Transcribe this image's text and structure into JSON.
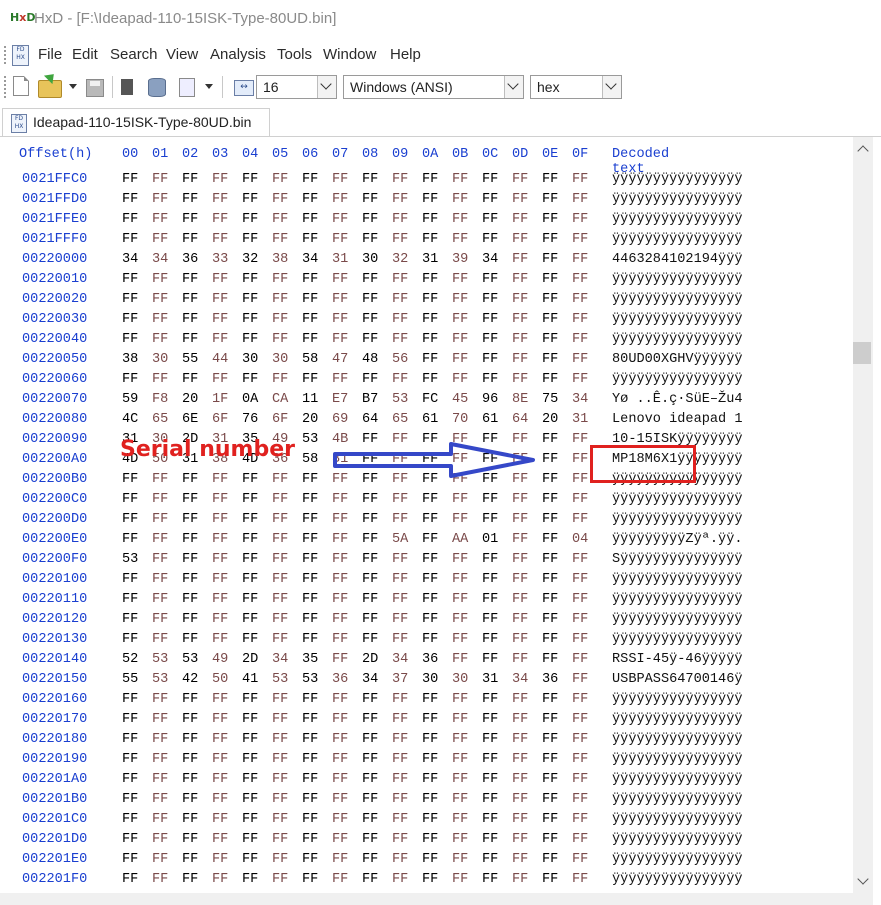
{
  "window": {
    "app_name": "HxD",
    "title": "HxD - [F:\\Ideapad-110-15ISK-Type-80UD.bin]",
    "icon": "hxd-app-icon"
  },
  "menu": {
    "doc_icon_text": "FD HX",
    "items": [
      "File",
      "Edit",
      "Search",
      "View",
      "Analysis",
      "Tools",
      "Window",
      "Help"
    ]
  },
  "toolbar": {
    "bytes_per_row": "16",
    "charset": "Windows (ANSI)",
    "offset_base": "hex",
    "icons": [
      "new-file-icon",
      "open-file-icon",
      "save-icon",
      "close-file-icon",
      "disk-icon",
      "file-properties-icon",
      "columns-icon"
    ]
  },
  "tab": {
    "label": "Ideapad-110-15ISK-Type-80UD.bin",
    "icon_text": "FD HX"
  },
  "editor": {
    "offset_header": "Offset(h)",
    "columns": [
      "00",
      "01",
      "02",
      "03",
      "04",
      "05",
      "06",
      "07",
      "08",
      "09",
      "0A",
      "0B",
      "0C",
      "0D",
      "0E",
      "0F"
    ],
    "decoded_header": "Decoded text",
    "rows": [
      {
        "offset": "0021FFC0",
        "bytes": [
          "FF",
          "FF",
          "FF",
          "FF",
          "FF",
          "FF",
          "FF",
          "FF",
          "FF",
          "FF",
          "FF",
          "FF",
          "FF",
          "FF",
          "FF",
          "FF"
        ],
        "text": "ÿÿÿÿÿÿÿÿÿÿÿÿÿÿÿÿ"
      },
      {
        "offset": "0021FFD0",
        "bytes": [
          "FF",
          "FF",
          "FF",
          "FF",
          "FF",
          "FF",
          "FF",
          "FF",
          "FF",
          "FF",
          "FF",
          "FF",
          "FF",
          "FF",
          "FF",
          "FF"
        ],
        "text": "ÿÿÿÿÿÿÿÿÿÿÿÿÿÿÿÿ"
      },
      {
        "offset": "0021FFE0",
        "bytes": [
          "FF",
          "FF",
          "FF",
          "FF",
          "FF",
          "FF",
          "FF",
          "FF",
          "FF",
          "FF",
          "FF",
          "FF",
          "FF",
          "FF",
          "FF",
          "FF"
        ],
        "text": "ÿÿÿÿÿÿÿÿÿÿÿÿÿÿÿÿ"
      },
      {
        "offset": "0021FFF0",
        "bytes": [
          "FF",
          "FF",
          "FF",
          "FF",
          "FF",
          "FF",
          "FF",
          "FF",
          "FF",
          "FF",
          "FF",
          "FF",
          "FF",
          "FF",
          "FF",
          "FF"
        ],
        "text": "ÿÿÿÿÿÿÿÿÿÿÿÿÿÿÿÿ"
      },
      {
        "offset": "00220000",
        "bytes": [
          "34",
          "34",
          "36",
          "33",
          "32",
          "38",
          "34",
          "31",
          "30",
          "32",
          "31",
          "39",
          "34",
          "FF",
          "FF",
          "FF"
        ],
        "text": "4463284102194ÿÿÿ"
      },
      {
        "offset": "00220010",
        "bytes": [
          "FF",
          "FF",
          "FF",
          "FF",
          "FF",
          "FF",
          "FF",
          "FF",
          "FF",
          "FF",
          "FF",
          "FF",
          "FF",
          "FF",
          "FF",
          "FF"
        ],
        "text": "ÿÿÿÿÿÿÿÿÿÿÿÿÿÿÿÿ"
      },
      {
        "offset": "00220020",
        "bytes": [
          "FF",
          "FF",
          "FF",
          "FF",
          "FF",
          "FF",
          "FF",
          "FF",
          "FF",
          "FF",
          "FF",
          "FF",
          "FF",
          "FF",
          "FF",
          "FF"
        ],
        "text": "ÿÿÿÿÿÿÿÿÿÿÿÿÿÿÿÿ"
      },
      {
        "offset": "00220030",
        "bytes": [
          "FF",
          "FF",
          "FF",
          "FF",
          "FF",
          "FF",
          "FF",
          "FF",
          "FF",
          "FF",
          "FF",
          "FF",
          "FF",
          "FF",
          "FF",
          "FF"
        ],
        "text": "ÿÿÿÿÿÿÿÿÿÿÿÿÿÿÿÿ"
      },
      {
        "offset": "00220040",
        "bytes": [
          "FF",
          "FF",
          "FF",
          "FF",
          "FF",
          "FF",
          "FF",
          "FF",
          "FF",
          "FF",
          "FF",
          "FF",
          "FF",
          "FF",
          "FF",
          "FF"
        ],
        "text": "ÿÿÿÿÿÿÿÿÿÿÿÿÿÿÿÿ"
      },
      {
        "offset": "00220050",
        "bytes": [
          "38",
          "30",
          "55",
          "44",
          "30",
          "30",
          "58",
          "47",
          "48",
          "56",
          "FF",
          "FF",
          "FF",
          "FF",
          "FF",
          "FF"
        ],
        "text": "80UD00XGHVÿÿÿÿÿÿ"
      },
      {
        "offset": "00220060",
        "bytes": [
          "FF",
          "FF",
          "FF",
          "FF",
          "FF",
          "FF",
          "FF",
          "FF",
          "FF",
          "FF",
          "FF",
          "FF",
          "FF",
          "FF",
          "FF",
          "FF"
        ],
        "text": "ÿÿÿÿÿÿÿÿÿÿÿÿÿÿÿÿ"
      },
      {
        "offset": "00220070",
        "bytes": [
          "59",
          "F8",
          "20",
          "1F",
          "0A",
          "CA",
          "11",
          "E7",
          "B7",
          "53",
          "FC",
          "45",
          "96",
          "8E",
          "75",
          "34"
        ],
        "text": "Yø ..Ê.ç·SüE–Žu4"
      },
      {
        "offset": "00220080",
        "bytes": [
          "4C",
          "65",
          "6E",
          "6F",
          "76",
          "6F",
          "20",
          "69",
          "64",
          "65",
          "61",
          "70",
          "61",
          "64",
          "20",
          "31"
        ],
        "text": "Lenovo ideapad 1"
      },
      {
        "offset": "00220090",
        "bytes": [
          "31",
          "30",
          "2D",
          "31",
          "35",
          "49",
          "53",
          "4B",
          "FF",
          "FF",
          "FF",
          "FF",
          "FF",
          "FF",
          "FF",
          "FF"
        ],
        "text": "10-15ISKÿÿÿÿÿÿÿÿ"
      },
      {
        "offset": "002200A0",
        "bytes": [
          "4D",
          "50",
          "31",
          "38",
          "4D",
          "36",
          "58",
          "31",
          "FF",
          "FF",
          "FF",
          "FF",
          "FF",
          "FF",
          "FF",
          "FF"
        ],
        "text": "MP18M6X1ÿÿÿÿÿÿÿÿ"
      },
      {
        "offset": "002200B0",
        "bytes": [
          "FF",
          "FF",
          "FF",
          "FF",
          "FF",
          "FF",
          "FF",
          "FF",
          "FF",
          "FF",
          "FF",
          "FF",
          "FF",
          "FF",
          "FF",
          "FF"
        ],
        "text": "ÿÿÿÿÿÿÿÿÿÿÿÿÿÿÿÿ"
      },
      {
        "offset": "002200C0",
        "bytes": [
          "FF",
          "FF",
          "FF",
          "FF",
          "FF",
          "FF",
          "FF",
          "FF",
          "FF",
          "FF",
          "FF",
          "FF",
          "FF",
          "FF",
          "FF",
          "FF"
        ],
        "text": "ÿÿÿÿÿÿÿÿÿÿÿÿÿÿÿÿ"
      },
      {
        "offset": "002200D0",
        "bytes": [
          "FF",
          "FF",
          "FF",
          "FF",
          "FF",
          "FF",
          "FF",
          "FF",
          "FF",
          "FF",
          "FF",
          "FF",
          "FF",
          "FF",
          "FF",
          "FF"
        ],
        "text": "ÿÿÿÿÿÿÿÿÿÿÿÿÿÿÿÿ"
      },
      {
        "offset": "002200E0",
        "bytes": [
          "FF",
          "FF",
          "FF",
          "FF",
          "FF",
          "FF",
          "FF",
          "FF",
          "FF",
          "5A",
          "FF",
          "AA",
          "01",
          "FF",
          "FF",
          "04"
        ],
        "text": "ÿÿÿÿÿÿÿÿÿZÿª.ÿÿ."
      },
      {
        "offset": "002200F0",
        "bytes": [
          "53",
          "FF",
          "FF",
          "FF",
          "FF",
          "FF",
          "FF",
          "FF",
          "FF",
          "FF",
          "FF",
          "FF",
          "FF",
          "FF",
          "FF",
          "FF"
        ],
        "text": "Sÿÿÿÿÿÿÿÿÿÿÿÿÿÿÿ"
      },
      {
        "offset": "00220100",
        "bytes": [
          "FF",
          "FF",
          "FF",
          "FF",
          "FF",
          "FF",
          "FF",
          "FF",
          "FF",
          "FF",
          "FF",
          "FF",
          "FF",
          "FF",
          "FF",
          "FF"
        ],
        "text": "ÿÿÿÿÿÿÿÿÿÿÿÿÿÿÿÿ"
      },
      {
        "offset": "00220110",
        "bytes": [
          "FF",
          "FF",
          "FF",
          "FF",
          "FF",
          "FF",
          "FF",
          "FF",
          "FF",
          "FF",
          "FF",
          "FF",
          "FF",
          "FF",
          "FF",
          "FF"
        ],
        "text": "ÿÿÿÿÿÿÿÿÿÿÿÿÿÿÿÿ"
      },
      {
        "offset": "00220120",
        "bytes": [
          "FF",
          "FF",
          "FF",
          "FF",
          "FF",
          "FF",
          "FF",
          "FF",
          "FF",
          "FF",
          "FF",
          "FF",
          "FF",
          "FF",
          "FF",
          "FF"
        ],
        "text": "ÿÿÿÿÿÿÿÿÿÿÿÿÿÿÿÿ"
      },
      {
        "offset": "00220130",
        "bytes": [
          "FF",
          "FF",
          "FF",
          "FF",
          "FF",
          "FF",
          "FF",
          "FF",
          "FF",
          "FF",
          "FF",
          "FF",
          "FF",
          "FF",
          "FF",
          "FF"
        ],
        "text": "ÿÿÿÿÿÿÿÿÿÿÿÿÿÿÿÿ"
      },
      {
        "offset": "00220140",
        "bytes": [
          "52",
          "53",
          "53",
          "49",
          "2D",
          "34",
          "35",
          "FF",
          "2D",
          "34",
          "36",
          "FF",
          "FF",
          "FF",
          "FF",
          "FF"
        ],
        "text": "RSSI-45ÿ-46ÿÿÿÿÿ"
      },
      {
        "offset": "00220150",
        "bytes": [
          "55",
          "53",
          "42",
          "50",
          "41",
          "53",
          "53",
          "36",
          "34",
          "37",
          "30",
          "30",
          "31",
          "34",
          "36",
          "FF"
        ],
        "text": "USBPASS64700146ÿ"
      },
      {
        "offset": "00220160",
        "bytes": [
          "FF",
          "FF",
          "FF",
          "FF",
          "FF",
          "FF",
          "FF",
          "FF",
          "FF",
          "FF",
          "FF",
          "FF",
          "FF",
          "FF",
          "FF",
          "FF"
        ],
        "text": "ÿÿÿÿÿÿÿÿÿÿÿÿÿÿÿÿ"
      },
      {
        "offset": "00220170",
        "bytes": [
          "FF",
          "FF",
          "FF",
          "FF",
          "FF",
          "FF",
          "FF",
          "FF",
          "FF",
          "FF",
          "FF",
          "FF",
          "FF",
          "FF",
          "FF",
          "FF"
        ],
        "text": "ÿÿÿÿÿÿÿÿÿÿÿÿÿÿÿÿ"
      },
      {
        "offset": "00220180",
        "bytes": [
          "FF",
          "FF",
          "FF",
          "FF",
          "FF",
          "FF",
          "FF",
          "FF",
          "FF",
          "FF",
          "FF",
          "FF",
          "FF",
          "FF",
          "FF",
          "FF"
        ],
        "text": "ÿÿÿÿÿÿÿÿÿÿÿÿÿÿÿÿ"
      },
      {
        "offset": "00220190",
        "bytes": [
          "FF",
          "FF",
          "FF",
          "FF",
          "FF",
          "FF",
          "FF",
          "FF",
          "FF",
          "FF",
          "FF",
          "FF",
          "FF",
          "FF",
          "FF",
          "FF"
        ],
        "text": "ÿÿÿÿÿÿÿÿÿÿÿÿÿÿÿÿ"
      },
      {
        "offset": "002201A0",
        "bytes": [
          "FF",
          "FF",
          "FF",
          "FF",
          "FF",
          "FF",
          "FF",
          "FF",
          "FF",
          "FF",
          "FF",
          "FF",
          "FF",
          "FF",
          "FF",
          "FF"
        ],
        "text": "ÿÿÿÿÿÿÿÿÿÿÿÿÿÿÿÿ"
      },
      {
        "offset": "002201B0",
        "bytes": [
          "FF",
          "FF",
          "FF",
          "FF",
          "FF",
          "FF",
          "FF",
          "FF",
          "FF",
          "FF",
          "FF",
          "FF",
          "FF",
          "FF",
          "FF",
          "FF"
        ],
        "text": "ÿÿÿÿÿÿÿÿÿÿÿÿÿÿÿÿ"
      },
      {
        "offset": "002201C0",
        "bytes": [
          "FF",
          "FF",
          "FF",
          "FF",
          "FF",
          "FF",
          "FF",
          "FF",
          "FF",
          "FF",
          "FF",
          "FF",
          "FF",
          "FF",
          "FF",
          "FF"
        ],
        "text": "ÿÿÿÿÿÿÿÿÿÿÿÿÿÿÿÿ"
      },
      {
        "offset": "002201D0",
        "bytes": [
          "FF",
          "FF",
          "FF",
          "FF",
          "FF",
          "FF",
          "FF",
          "FF",
          "FF",
          "FF",
          "FF",
          "FF",
          "FF",
          "FF",
          "FF",
          "FF"
        ],
        "text": "ÿÿÿÿÿÿÿÿÿÿÿÿÿÿÿÿ"
      },
      {
        "offset": "002201E0",
        "bytes": [
          "FF",
          "FF",
          "FF",
          "FF",
          "FF",
          "FF",
          "FF",
          "FF",
          "FF",
          "FF",
          "FF",
          "FF",
          "FF",
          "FF",
          "FF",
          "FF"
        ],
        "text": "ÿÿÿÿÿÿÿÿÿÿÿÿÿÿÿÿ"
      },
      {
        "offset": "002201F0",
        "bytes": [
          "FF",
          "FF",
          "FF",
          "FF",
          "FF",
          "FF",
          "FF",
          "FF",
          "FF",
          "FF",
          "FF",
          "FF",
          "FF",
          "FF",
          "FF",
          "FF"
        ],
        "text": "ÿÿÿÿÿÿÿÿÿÿÿÿÿÿÿÿ"
      }
    ]
  },
  "annotation": {
    "label": "Serial number",
    "color": "#e0211f",
    "arrow_color": "#3548c8"
  }
}
